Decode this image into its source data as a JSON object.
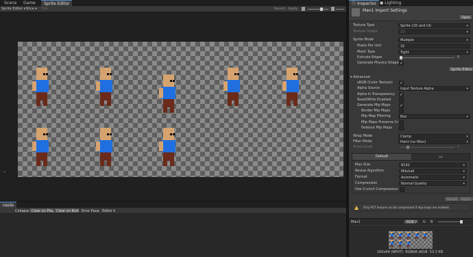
{
  "left_tabs": [
    "Scene",
    "Game",
    "Sprite Editor"
  ],
  "right_tabs": [
    "Inspector",
    "Lighting"
  ],
  "editor_toolbar": {
    "mode": "Sprite Editor",
    "slice": "Slice",
    "trim": "Trim",
    "revert": "Revert",
    "apply": "Apply"
  },
  "inspector": {
    "title": "Man1 Import Settings",
    "open_button": "Open",
    "texture_type": {
      "label": "Texture Type",
      "value": "Sprite (2D and UI)"
    },
    "texture_shape": {
      "label": "Texture Shape",
      "value": "2D"
    },
    "sprite_mode": {
      "label": "Sprite Mode",
      "value": "Multiple"
    },
    "pixels_per_unit": {
      "label": "Pixels Per Unit",
      "value": "32"
    },
    "mesh_type": {
      "label": "Mesh Type",
      "value": "Tight"
    },
    "extrude_edges": {
      "label": "Extrude Edges",
      "value": "0"
    },
    "generate_physics_shape": {
      "label": "Generate Physics Shape"
    },
    "sprite_editor_button": "Sprite Editor",
    "advanced": "Advanced",
    "srgb": {
      "label": "sRGB (Color Texture)"
    },
    "alpha_source": {
      "label": "Alpha Source",
      "value": "Input Texture Alpha"
    },
    "alpha_transparency": {
      "label": "Alpha Is Transparency"
    },
    "read_write": {
      "label": "Read/Write Enabled"
    },
    "generate_mip_maps": {
      "label": "Generate Mip Maps"
    },
    "border_mip_maps": {
      "label": "Border Mip Maps"
    },
    "mip_map_filtering": {
      "label": "Mip Map Filtering",
      "value": "Box"
    },
    "mip_maps_preserve": {
      "label": "Mip Maps Preserve Cc"
    },
    "fadeout_mip_maps": {
      "label": "Fadeout Mip Maps"
    },
    "wrap_mode": {
      "label": "Wrap Mode",
      "value": "Clamp"
    },
    "filter_mode": {
      "label": "Filter Mode",
      "value": "Point (no filter)"
    },
    "aniso_level": {
      "label": "Aniso Level",
      "value": "2"
    },
    "platform_tab": "Default",
    "max_size": {
      "label": "Max Size",
      "value": "8192"
    },
    "resize_algorithm": {
      "label": "Resize Algorithm",
      "value": "Mitchell"
    },
    "format": {
      "label": "Format",
      "value": "Automatic"
    },
    "compression": {
      "label": "Compression",
      "value": "Normal Quality"
    },
    "use_crunch": {
      "label": "Use Crunch Compression"
    },
    "revert": "Revert",
    "apply": "Apply",
    "warning": "Only POT texture can be compressed if mip-maps are enabled."
  },
  "preview": {
    "name": "Man1",
    "channels": [
      "RGB",
      "R",
      "G",
      "B"
    ],
    "info": "160x64 (NPOT)  RGBA8 sRGB  53.3 KB"
  },
  "console": {
    "tab": "nsole",
    "buttons": [
      "Collapse",
      "Clear on Play",
      "Clear on Build",
      "Error Pause",
      "Editor"
    ]
  },
  "colors": {
    "skin": "#d6a36f",
    "shirt": "#1f6fe0",
    "pants": "#6b2a1a",
    "accent": "#5a8bd6"
  }
}
